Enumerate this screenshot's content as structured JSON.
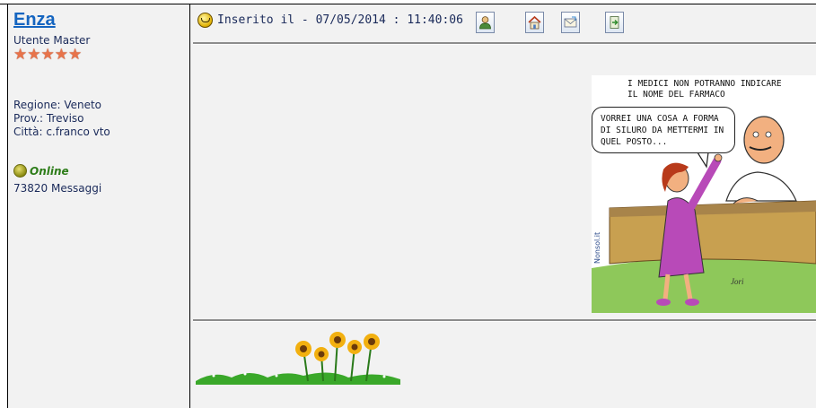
{
  "author": {
    "name": "Enza",
    "rank": "Utente Master",
    "stars": 5,
    "region": "Regione: Veneto",
    "province": "Prov.: Treviso",
    "city": "Città: c.franco vto",
    "status": "Online",
    "messages": "73820 Messaggi"
  },
  "post": {
    "date_label": "Inserito il - 07/05/2014 : 11:40:06",
    "toolbar": [
      {
        "name": "profile-icon"
      },
      {
        "name": "home-icon"
      },
      {
        "name": "email-icon"
      },
      {
        "name": "reply-icon"
      }
    ],
    "cartoon": {
      "caption_line1": "I MEDICI NON POTRANNO INDICARE",
      "caption_line2": "IL NOME DEL FARMACO",
      "bubble_line1": "VORREI UNA COSA A FORMA",
      "bubble_line2": "DI SILURO DA METTERMI IN",
      "bubble_line3": "QUEL POSTO...",
      "watermark": "Nonsol.it"
    }
  },
  "colors": {
    "link": "#1565c0",
    "text": "#1a2a5a",
    "online": "#2e7d1a",
    "panel_bg": "#f2f2f2"
  }
}
